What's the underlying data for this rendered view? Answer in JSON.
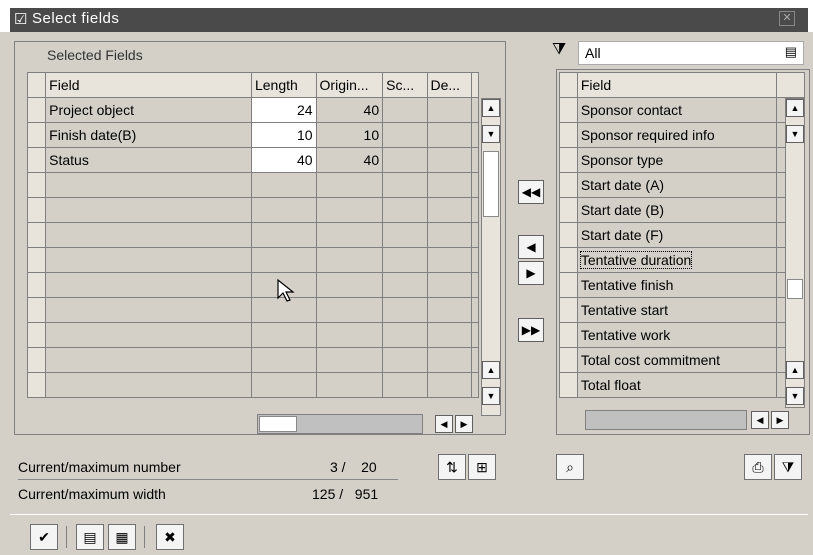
{
  "window": {
    "title": "Select fields",
    "title_icon": "☑"
  },
  "left_panel": {
    "title": "Selected Fields",
    "columns": [
      "Field",
      "Length",
      "Origin...",
      "Sc...",
      "De..."
    ],
    "rows": [
      {
        "field": "Project object",
        "length": "24",
        "origin": "40"
      },
      {
        "field": "Finish date(B)",
        "length": "10",
        "origin": "10"
      },
      {
        "field": "Status",
        "length": "40",
        "origin": "40"
      }
    ]
  },
  "right_panel": {
    "filter": "All",
    "column": "Field",
    "rows": [
      "Sponsor contact",
      "Sponsor required info",
      "Sponsor type",
      "Start date (A)",
      "Start date (B)",
      "Start date (F)",
      "Tentative duration",
      "Tentative finish",
      "Tentative start",
      "Tentative work",
      "Total cost commitment",
      "Total float"
    ]
  },
  "footer": {
    "num_label": "Current/maximum number",
    "num_value": "3 /    20",
    "width_label": "Current/maximum width",
    "width_value": "125 /   951"
  }
}
